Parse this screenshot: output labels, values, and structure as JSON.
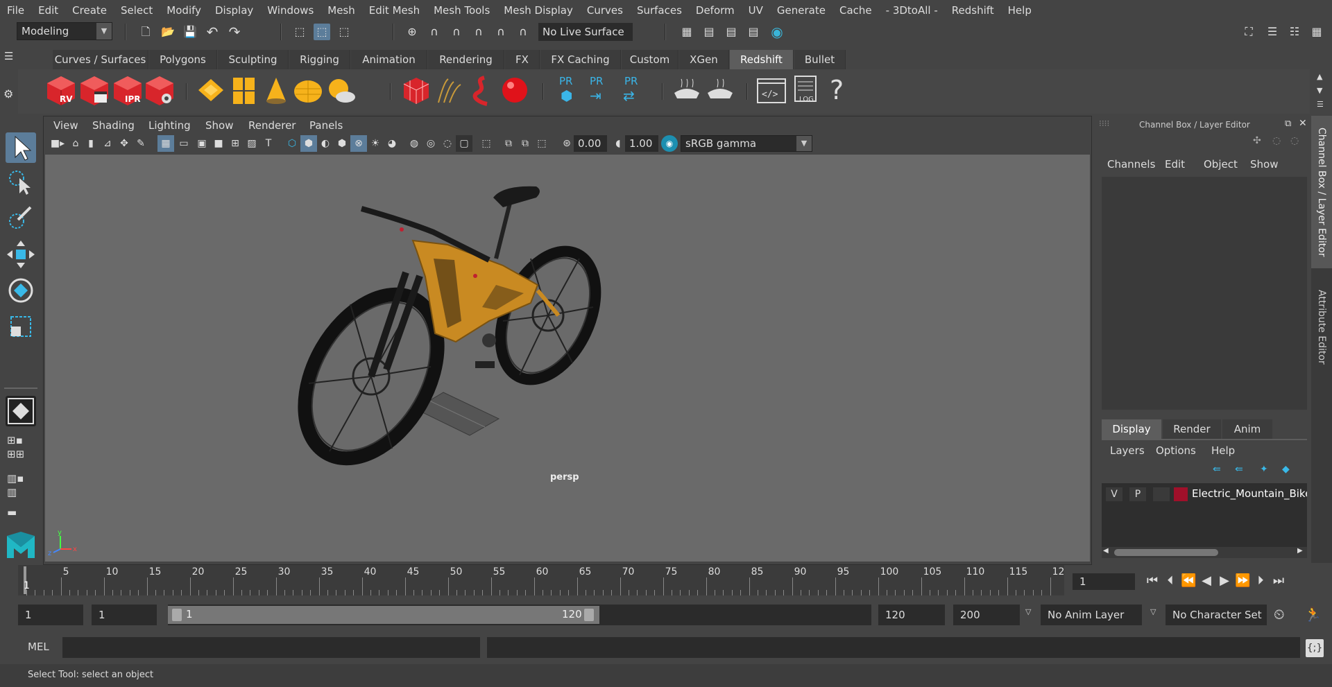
{
  "menu": [
    "File",
    "Edit",
    "Create",
    "Select",
    "Modify",
    "Display",
    "Windows",
    "Mesh",
    "Edit Mesh",
    "Mesh Tools",
    "Mesh Display",
    "Curves",
    "Surfaces",
    "Deform",
    "UV",
    "Generate",
    "Cache",
    "- 3DtoAll -",
    "Redshift",
    "Help"
  ],
  "status": {
    "workspace": "Modeling",
    "live_surface": "No Live Surface"
  },
  "shelf": {
    "tabs": [
      "Curves / Surfaces",
      "Polygons",
      "Sculpting",
      "Rigging",
      "Animation",
      "Rendering",
      "FX",
      "FX Caching",
      "Custom",
      "XGen",
      "Redshift",
      "Bullet"
    ],
    "active_tab": "Redshift",
    "icon_labels": {
      "rv": "RV",
      "ipr": "IPR",
      "pr": "PR",
      "log": "LOG",
      "help": "?"
    }
  },
  "viewport": {
    "panel_menu": [
      "View",
      "Shading",
      "Lighting",
      "Show",
      "Renderer",
      "Panels"
    ],
    "exposure": "0.00",
    "gamma": "1.00",
    "color_space": "sRGB gamma",
    "camera": "persp",
    "colors": {
      "frame": "#c98a22",
      "background": "#6a6a6a"
    }
  },
  "channel_box": {
    "title": "Channel Box / Layer Editor",
    "menu": [
      "Channels",
      "Edit",
      "Object",
      "Show"
    ],
    "layer_tabs": [
      "Display",
      "Render",
      "Anim"
    ],
    "active_layer_tab": "Display",
    "layer_menu": [
      "Layers",
      "Options",
      "Help"
    ],
    "layer": {
      "v": "V",
      "p": "P",
      "name": "Electric_Mountain_Bike",
      "color": "#a0102a"
    }
  },
  "side_tabs": [
    "Channel Box / Layer Editor",
    "Attribute Editor"
  ],
  "timeline": {
    "ticks": [
      "5",
      "10",
      "15",
      "20",
      "25",
      "30",
      "35",
      "40",
      "45",
      "50",
      "55",
      "60",
      "65",
      "70",
      "75",
      "80",
      "85",
      "90",
      "95",
      "100",
      "105",
      "110",
      "115",
      "12"
    ],
    "start_marker": "1",
    "current_frame": "1"
  },
  "range": {
    "start": "1",
    "playback_start": "1",
    "slider_start": "1",
    "slider_end": "120",
    "playback_end": "120",
    "end": "200",
    "anim_layer": "No Anim Layer",
    "character_set": "No Character Set"
  },
  "command": {
    "language": "MEL"
  },
  "status_bar": "Select Tool: select an object"
}
